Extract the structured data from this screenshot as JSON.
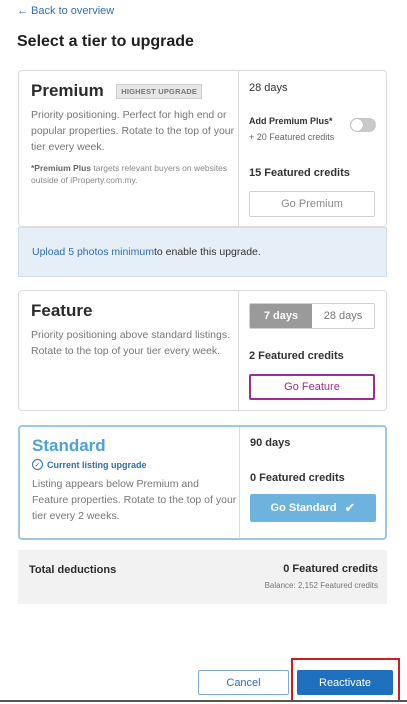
{
  "back_link": "← Back to overview",
  "page_title": "Select a tier to upgrade",
  "premium": {
    "name": "Premium",
    "badge": "HIGHEST UPGRADE",
    "description": "Priority positioning. Perfect for high end or popular properties. Rotate to the top of your tier every week.",
    "note_bold": "*Premium Plus",
    "note_rest": " targets relevant buyers on websites outside of iProperty.com.my.",
    "duration": "28 days",
    "addon_label": "Add Premium Plus*",
    "addon_credits": "+ 20 Featured credits",
    "toggle_on": false,
    "credits": "15 Featured credits",
    "button": "Go Premium"
  },
  "info_banner": {
    "link": "Upload 5 photos minimum",
    "text": " to enable this upgrade."
  },
  "feature": {
    "name": "Feature",
    "description": "Priority positioning above standard listings. Rotate to the top of your tier every week.",
    "duration_options": [
      "7 days",
      "28 days"
    ],
    "selected_duration": "7 days",
    "credits": "2 Featured credits",
    "button": "Go Feature"
  },
  "standard": {
    "name": "Standard",
    "current_label": "Current listing upgrade",
    "description": "Listing appears below Premium and Feature properties. Rotate to the top of your tier every 2 weeks.",
    "duration": "90 days",
    "credits": "0 Featured credits",
    "button": "Go Standard"
  },
  "totals": {
    "label": "Total deductions",
    "credits": "0 Featured credits",
    "balance": "Balance: 2,152 Featured credits"
  },
  "footer": {
    "cancel": "Cancel",
    "reactivate": "Reactivate"
  },
  "colors": {
    "link_blue": "#2f6fb0",
    "feature_purple": "#9a2f8f",
    "standard_blue": "#4ba3d6",
    "primary_button": "#1e6fbd",
    "highlight_red": "#d01c1c"
  }
}
